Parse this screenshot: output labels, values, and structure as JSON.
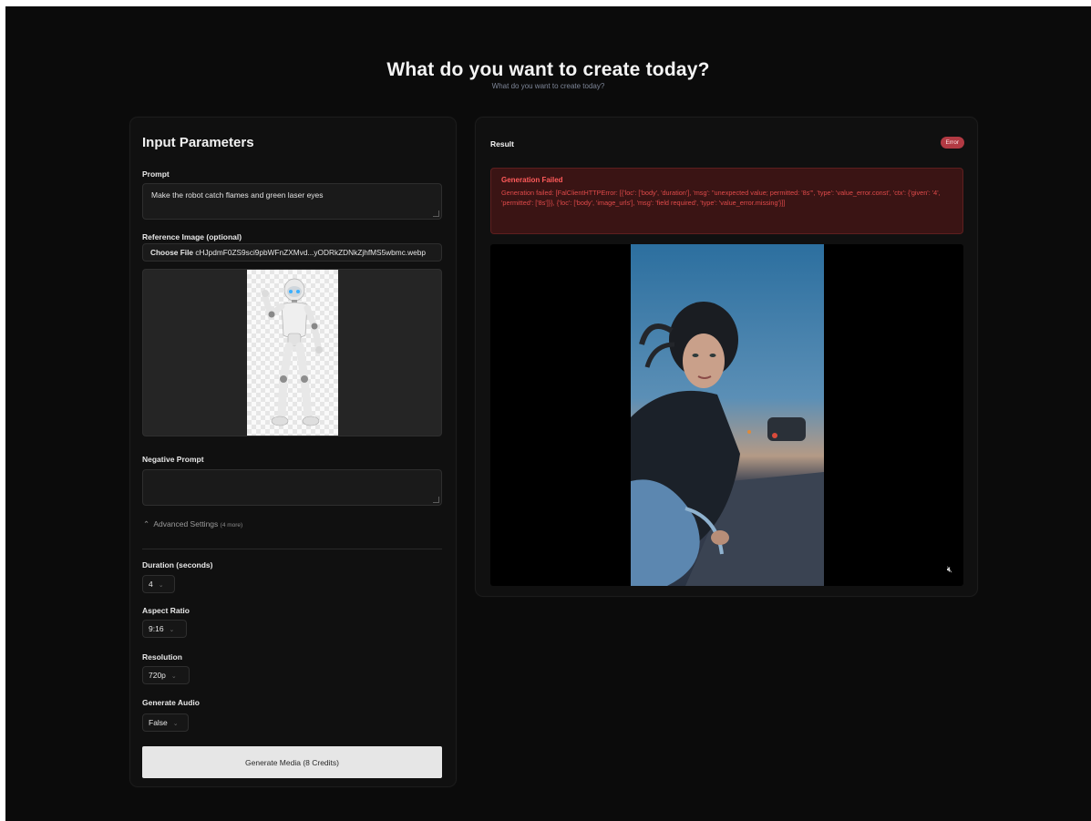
{
  "header": {
    "title": "What do you want to create today?",
    "subtitle": "What do you want to create today?"
  },
  "input_panel": {
    "title": "Input Parameters",
    "prompt_label": "Prompt",
    "prompt_value": "Make the robot catch flames and green laser eyes",
    "reference_label": "Reference Image (optional)",
    "file_button": "Choose File",
    "file_name": "cHJpdmF0ZS9sci9pbWFnZXMvd...yODRkZDNkZjhfMS5wbmc.webp",
    "negative_label": "Negative Prompt",
    "negative_value": "",
    "advanced_label": "Advanced Settings",
    "advanced_count": "(4 more)",
    "duration_label": "Duration (seconds)",
    "duration_value": "4",
    "aspect_label": "Aspect Ratio",
    "aspect_value": "9:16",
    "resolution_label": "Resolution",
    "resolution_value": "720p",
    "audio_label": "Generate Audio",
    "audio_value": "False",
    "generate_button": "Generate Media (8 Credits)"
  },
  "result_panel": {
    "title": "Result",
    "badge": "Error",
    "error_title": "Generation Failed",
    "error_message": "Generation failed: [FalClientHTTPError: [{'loc': ['body', 'duration'], 'msg': \"unexpected value; permitted: '8s'\", 'type': 'value_error.const', 'ctx': {'given': '4', 'permitted': ['8s']}}, {'loc': ['body', 'image_urls'], 'msg': 'field required', 'type': 'value_error.missing'}]]"
  },
  "icons": {
    "chevron": "chevron-down-icon",
    "advanced_toggle": "chevron-up-icon",
    "mute": "speaker-muted-icon"
  },
  "colors": {
    "background": "#0b0b0b",
    "panel": "#101010",
    "error_badge": "#b23a43",
    "error_text": "#ff5a5a",
    "button": "#e6e6e6"
  }
}
